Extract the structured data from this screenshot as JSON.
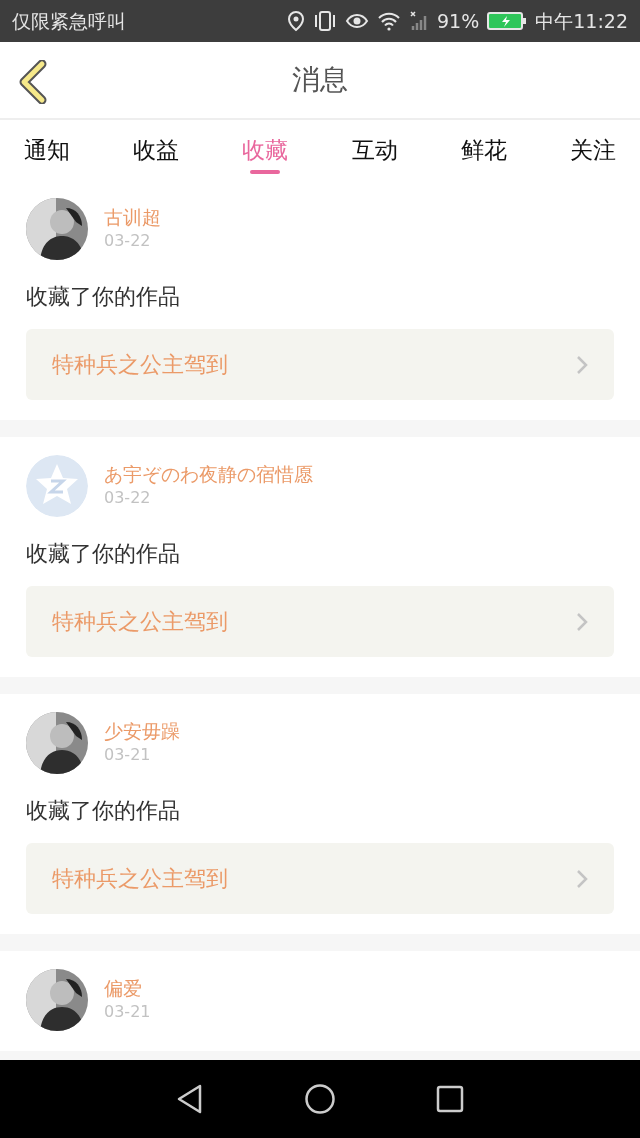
{
  "status_bar": {
    "carrier": "仅限紧急呼叫",
    "battery": "91%",
    "time": "中午11:22"
  },
  "header": {
    "title": "消息"
  },
  "tabs": [
    {
      "label": "通知",
      "selected": false
    },
    {
      "label": "收益",
      "selected": false
    },
    {
      "label": "收藏",
      "selected": true
    },
    {
      "label": "互动",
      "selected": false
    },
    {
      "label": "鲜花",
      "selected": false
    },
    {
      "label": "关注",
      "selected": false
    }
  ],
  "messages": [
    {
      "name": "古训超",
      "date": "03-22",
      "text": "收藏了你的作品",
      "work": "特种兵之公主驾到"
    },
    {
      "avatar": {
        "kind": "default"
      },
      "name": "あ宇ぞのわ夜静の宿惜愿",
      "date": "03-22",
      "text": "收藏了你的作品",
      "work": "特种兵之公主驾到"
    },
    {
      "name": "少安毋躁",
      "date": "03-21",
      "text": "收藏了你的作品",
      "work": "特种兵之公主驾到"
    },
    {
      "name": "偏爱",
      "date": "03-21"
    }
  ]
}
